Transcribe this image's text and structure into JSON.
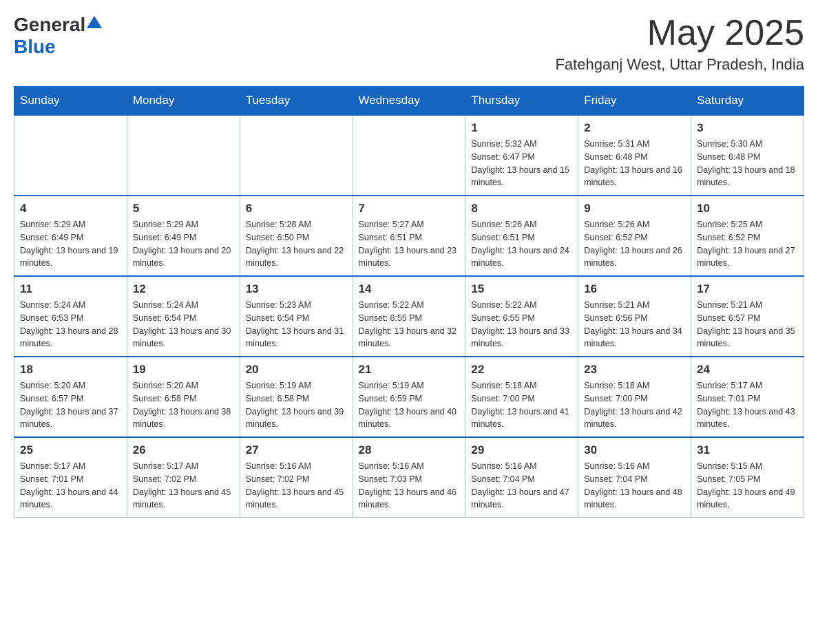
{
  "header": {
    "logo_general": "General",
    "logo_blue": "Blue",
    "month_year": "May 2025",
    "location": "Fatehganj West, Uttar Pradesh, India"
  },
  "days_of_week": [
    "Sunday",
    "Monday",
    "Tuesday",
    "Wednesday",
    "Thursday",
    "Friday",
    "Saturday"
  ],
  "weeks": [
    [
      {
        "day": "",
        "info": ""
      },
      {
        "day": "",
        "info": ""
      },
      {
        "day": "",
        "info": ""
      },
      {
        "day": "",
        "info": ""
      },
      {
        "day": "1",
        "info": "Sunrise: 5:32 AM\nSunset: 6:47 PM\nDaylight: 13 hours and 15 minutes."
      },
      {
        "day": "2",
        "info": "Sunrise: 5:31 AM\nSunset: 6:48 PM\nDaylight: 13 hours and 16 minutes."
      },
      {
        "day": "3",
        "info": "Sunrise: 5:30 AM\nSunset: 6:48 PM\nDaylight: 13 hours and 18 minutes."
      }
    ],
    [
      {
        "day": "4",
        "info": "Sunrise: 5:29 AM\nSunset: 6:49 PM\nDaylight: 13 hours and 19 minutes."
      },
      {
        "day": "5",
        "info": "Sunrise: 5:29 AM\nSunset: 6:49 PM\nDaylight: 13 hours and 20 minutes."
      },
      {
        "day": "6",
        "info": "Sunrise: 5:28 AM\nSunset: 6:50 PM\nDaylight: 13 hours and 22 minutes."
      },
      {
        "day": "7",
        "info": "Sunrise: 5:27 AM\nSunset: 6:51 PM\nDaylight: 13 hours and 23 minutes."
      },
      {
        "day": "8",
        "info": "Sunrise: 5:26 AM\nSunset: 6:51 PM\nDaylight: 13 hours and 24 minutes."
      },
      {
        "day": "9",
        "info": "Sunrise: 5:26 AM\nSunset: 6:52 PM\nDaylight: 13 hours and 26 minutes."
      },
      {
        "day": "10",
        "info": "Sunrise: 5:25 AM\nSunset: 6:52 PM\nDaylight: 13 hours and 27 minutes."
      }
    ],
    [
      {
        "day": "11",
        "info": "Sunrise: 5:24 AM\nSunset: 6:53 PM\nDaylight: 13 hours and 28 minutes."
      },
      {
        "day": "12",
        "info": "Sunrise: 5:24 AM\nSunset: 6:54 PM\nDaylight: 13 hours and 30 minutes."
      },
      {
        "day": "13",
        "info": "Sunrise: 5:23 AM\nSunset: 6:54 PM\nDaylight: 13 hours and 31 minutes."
      },
      {
        "day": "14",
        "info": "Sunrise: 5:22 AM\nSunset: 6:55 PM\nDaylight: 13 hours and 32 minutes."
      },
      {
        "day": "15",
        "info": "Sunrise: 5:22 AM\nSunset: 6:55 PM\nDaylight: 13 hours and 33 minutes."
      },
      {
        "day": "16",
        "info": "Sunrise: 5:21 AM\nSunset: 6:56 PM\nDaylight: 13 hours and 34 minutes."
      },
      {
        "day": "17",
        "info": "Sunrise: 5:21 AM\nSunset: 6:57 PM\nDaylight: 13 hours and 35 minutes."
      }
    ],
    [
      {
        "day": "18",
        "info": "Sunrise: 5:20 AM\nSunset: 6:57 PM\nDaylight: 13 hours and 37 minutes."
      },
      {
        "day": "19",
        "info": "Sunrise: 5:20 AM\nSunset: 6:58 PM\nDaylight: 13 hours and 38 minutes."
      },
      {
        "day": "20",
        "info": "Sunrise: 5:19 AM\nSunset: 6:58 PM\nDaylight: 13 hours and 39 minutes."
      },
      {
        "day": "21",
        "info": "Sunrise: 5:19 AM\nSunset: 6:59 PM\nDaylight: 13 hours and 40 minutes."
      },
      {
        "day": "22",
        "info": "Sunrise: 5:18 AM\nSunset: 7:00 PM\nDaylight: 13 hours and 41 minutes."
      },
      {
        "day": "23",
        "info": "Sunrise: 5:18 AM\nSunset: 7:00 PM\nDaylight: 13 hours and 42 minutes."
      },
      {
        "day": "24",
        "info": "Sunrise: 5:17 AM\nSunset: 7:01 PM\nDaylight: 13 hours and 43 minutes."
      }
    ],
    [
      {
        "day": "25",
        "info": "Sunrise: 5:17 AM\nSunset: 7:01 PM\nDaylight: 13 hours and 44 minutes."
      },
      {
        "day": "26",
        "info": "Sunrise: 5:17 AM\nSunset: 7:02 PM\nDaylight: 13 hours and 45 minutes."
      },
      {
        "day": "27",
        "info": "Sunrise: 5:16 AM\nSunset: 7:02 PM\nDaylight: 13 hours and 45 minutes."
      },
      {
        "day": "28",
        "info": "Sunrise: 5:16 AM\nSunset: 7:03 PM\nDaylight: 13 hours and 46 minutes."
      },
      {
        "day": "29",
        "info": "Sunrise: 5:16 AM\nSunset: 7:04 PM\nDaylight: 13 hours and 47 minutes."
      },
      {
        "day": "30",
        "info": "Sunrise: 5:16 AM\nSunset: 7:04 PM\nDaylight: 13 hours and 48 minutes."
      },
      {
        "day": "31",
        "info": "Sunrise: 5:15 AM\nSunset: 7:05 PM\nDaylight: 13 hours and 49 minutes."
      }
    ]
  ]
}
